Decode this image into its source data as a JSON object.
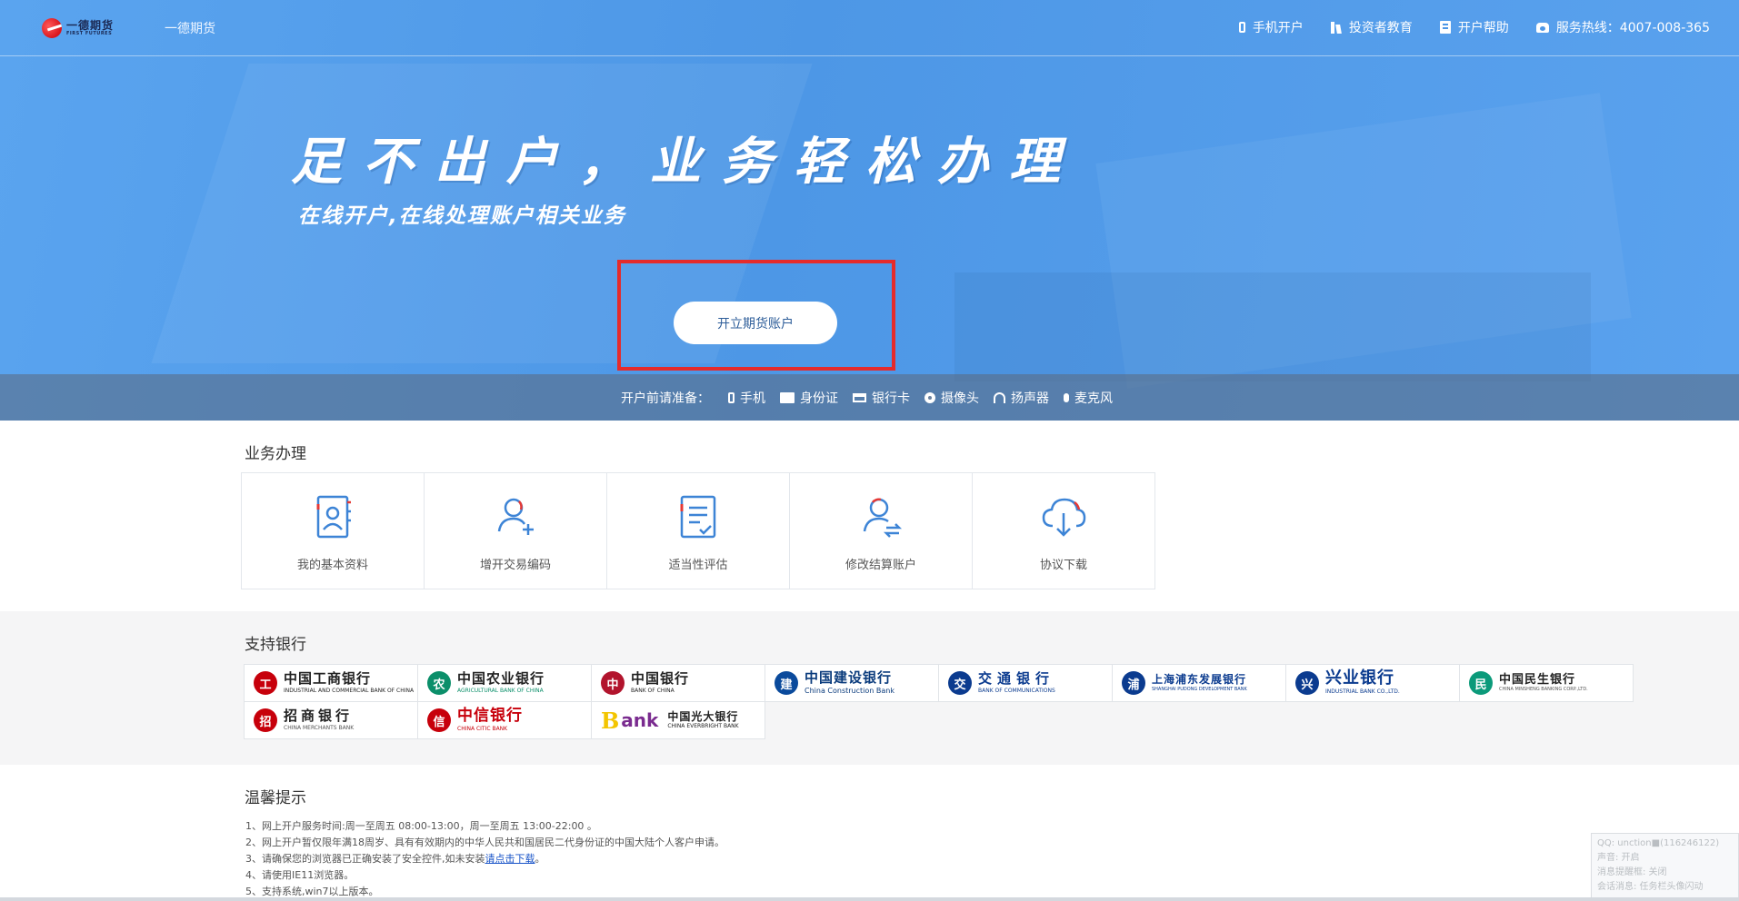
{
  "header": {
    "brand": "一德期货",
    "logo_text": "一德期货",
    "logo_sub": "FIRST FUTURES",
    "nav": [
      {
        "label": "手机开户",
        "icon": "mobile-icon"
      },
      {
        "label": "投资者教育",
        "icon": "books-icon"
      },
      {
        "label": "开户帮助",
        "icon": "document-icon"
      },
      {
        "label": "服务热线：4007-008-365",
        "icon": "telephone-icon"
      }
    ]
  },
  "hero": {
    "slogan": "足不出户，业务轻松办理",
    "subslogan": "在线开户,在线处理账户相关业务",
    "open_button": "开立期货账户",
    "highlight_color": "#e52b2b",
    "prep_label": "开户前请准备：",
    "prep_items": [
      {
        "label": "手机",
        "icon": "mobile-icon"
      },
      {
        "label": "身份证",
        "icon": "id-card-icon"
      },
      {
        "label": "银行卡",
        "icon": "bank-card-icon"
      },
      {
        "label": "摄像头",
        "icon": "camera-icon"
      },
      {
        "label": "扬声器",
        "icon": "headphones-icon"
      },
      {
        "label": "麦克风",
        "icon": "microphone-icon"
      }
    ]
  },
  "business": {
    "title": "业务办理",
    "items": [
      {
        "label": "我的基本资料",
        "icon": "profile-book-icon"
      },
      {
        "label": "增开交易编码",
        "icon": "add-user-icon"
      },
      {
        "label": "适当性评估",
        "icon": "checklist-icon"
      },
      {
        "label": "修改结算账户",
        "icon": "user-transfer-icon"
      },
      {
        "label": "协议下载",
        "icon": "cloud-download-icon"
      }
    ]
  },
  "banks": {
    "title": "支持银行",
    "items": [
      {
        "cn": "中国工商银行",
        "en": "INDUSTRIAL AND COMMERCIAL BANK OF CHINA",
        "color": "#c7000b",
        "icon": "icbc-logo"
      },
      {
        "cn": "中国农业银行",
        "en": "AGRICULTURAL BANK OF CHINA",
        "color": "#0b8f6a",
        "icon": "abc-logo"
      },
      {
        "cn": "中国银行",
        "en": "BANK OF CHINA",
        "color": "#b2142d",
        "icon": "boc-logo"
      },
      {
        "cn": "中国建设银行",
        "en": "China Construction Bank",
        "color": "#0a4a9c",
        "icon": "ccb-logo"
      },
      {
        "cn": "交通银行",
        "en": "BANK OF COMMUNICATIONS",
        "color": "#0b3b8f",
        "icon": "bocom-logo"
      },
      {
        "cn": "上海浦东发展银行",
        "en": "SHANGHAI PUDONG DEVELOPMENT BANK",
        "color": "#0b3b8f",
        "icon": "spdb-logo"
      },
      {
        "cn": "兴业银行",
        "en": "INDUSTRIAL BANK CO.,LTD.",
        "color": "#0b3b8f",
        "icon": "cib-logo"
      },
      {
        "cn": "中国民生银行",
        "en": "CHINA MINSHENG BANKING CORP.,LTD.",
        "color": "#0b9a7a",
        "icon": "cmbc-logo"
      },
      {
        "cn": "招商银行",
        "en": "CHINA MERCHANTS BANK",
        "color": "#c7000b",
        "icon": "cmb-logo"
      },
      {
        "cn": "中信银行",
        "en": "CHINA CITIC BANK",
        "color": "#c7000b",
        "icon": "citic-logo"
      },
      {
        "cn": "中国光大银行",
        "en": "CHINA EVERBRIGHT BANK",
        "color": "#7a2b8f",
        "icon": "ceb-logo"
      }
    ]
  },
  "tips": {
    "title": "温馨提示",
    "items": [
      "1、网上开户服务时间:周一至周五 08:00-13:00，周一至周五 13:00-22:00 。",
      "2、网上开户暂仅限年满18周岁、具有有效期内的中华人民共和国居民二代身份证的中国大陆个人客户申请。",
      "3、请确保您的浏览器已正确安装了安全控件,如未安装",
      "4、请使用IE11浏览器。",
      "5、支持系统,win7以上版本。"
    ],
    "download_link": "请点击下载",
    "after_link": "。"
  },
  "qq_overlay": {
    "lines": [
      "QQ: unction■(116246122)",
      "声音: 开启",
      "消息提醒框: 关闭",
      "会话消息: 任务栏头像闪动"
    ]
  },
  "colors": {
    "hero_blue": "#4d97e6",
    "icon_blue": "#3d84d6",
    "icon_red": "#e53935"
  }
}
